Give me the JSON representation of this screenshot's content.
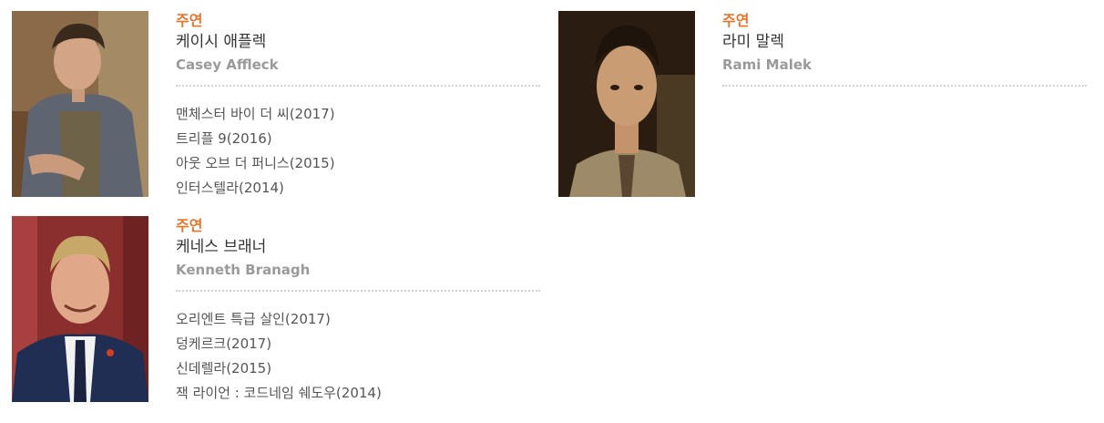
{
  "cast": [
    {
      "role": "주연",
      "name_ko": "케이시 애플렉",
      "name_en": "Casey Affleck",
      "works": [
        "맨체스터 바이 더 씨(2017)",
        "트리플 9(2016)",
        "아웃 오브 더 퍼니스(2015)",
        "인터스텔라(2014)"
      ]
    },
    {
      "role": "주연",
      "name_ko": "라미 말렉",
      "name_en": "Rami Malek",
      "works": []
    },
    {
      "role": "주연",
      "name_ko": "케네스 브래너",
      "name_en": "Kenneth Branagh",
      "works": [
        "오리엔트 특급 살인(2017)",
        "덩케르크(2017)",
        "신데렐라(2015)",
        "잭 라이언 : 코드네임 쉐도우(2014)"
      ]
    }
  ],
  "colors": {
    "role": "#e8742a",
    "name_ko": "#333333",
    "name_en": "#9a9a9a",
    "divider": "#d2d2d2"
  }
}
